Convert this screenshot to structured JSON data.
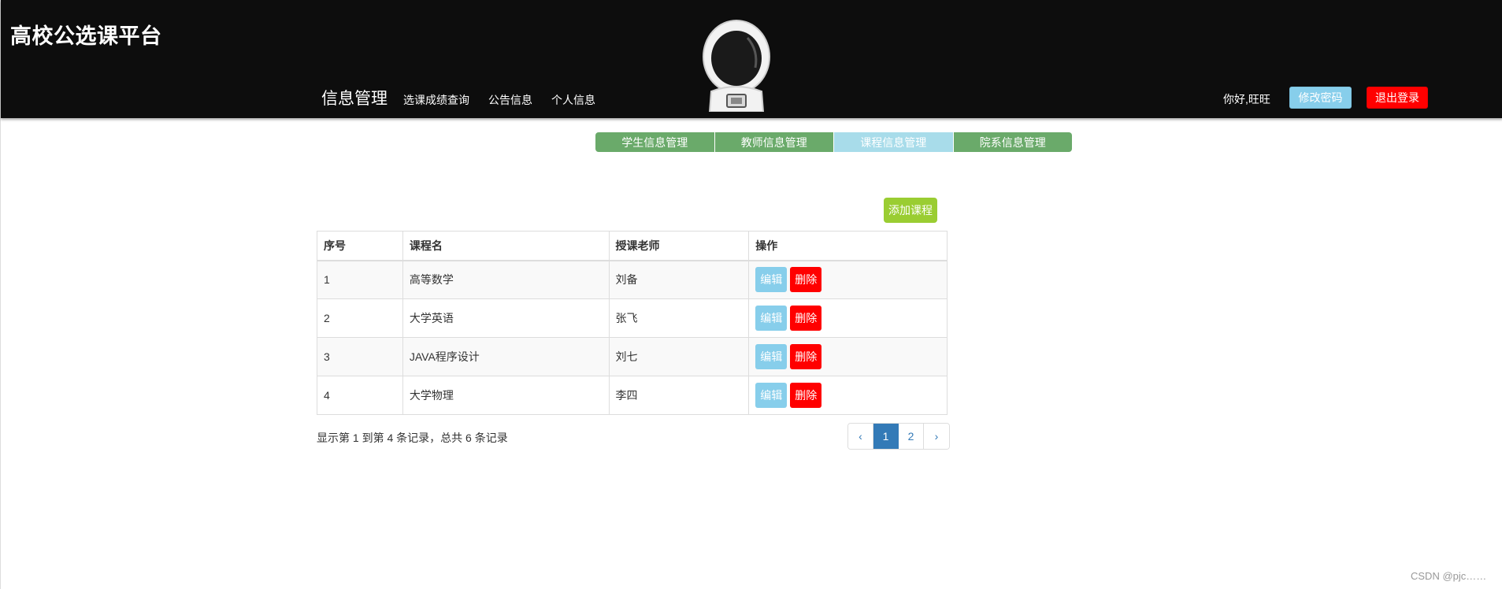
{
  "header": {
    "brand": "高校公选课平台",
    "nav_main": "信息管理",
    "nav_links": [
      "选课成绩查询",
      "公告信息",
      "个人信息"
    ],
    "greeting": "你好,旺旺",
    "change_password_label": "修改密码",
    "logout_label": "退出登录"
  },
  "subtabs": [
    {
      "label": "学生信息管理",
      "active": false
    },
    {
      "label": "教师信息管理",
      "active": false
    },
    {
      "label": "课程信息管理",
      "active": true
    },
    {
      "label": "院系信息管理",
      "active": false
    }
  ],
  "toolbar": {
    "add_course_label": "添加课程"
  },
  "table": {
    "headers": [
      "序号",
      "课程名",
      "授课老师",
      "操作"
    ],
    "rows": [
      {
        "id": "1",
        "course": "高等数学",
        "teacher": "刘备"
      },
      {
        "id": "2",
        "course": "大学英语",
        "teacher": "张飞"
      },
      {
        "id": "3",
        "course": "JAVA程序设计",
        "teacher": "刘七"
      },
      {
        "id": "4",
        "course": "大学物理",
        "teacher": "李四"
      }
    ],
    "edit_label": "编辑",
    "delete_label": "删除"
  },
  "pagination": {
    "info": "显示第 1 到第 4 条记录，总共 6 条记录",
    "prev": "‹",
    "pages": [
      "1",
      "2"
    ],
    "current": "1",
    "next": "›"
  },
  "watermark": "CSDN @pjc……",
  "colors": {
    "header_bg": "#0d0d0d",
    "tab_green": "#6aaa6a",
    "tab_active": "#a8dcea",
    "add_button": "#9acd32",
    "edit_button": "#87ceeb",
    "delete_button": "#ff0000",
    "page_active": "#337ab7"
  }
}
